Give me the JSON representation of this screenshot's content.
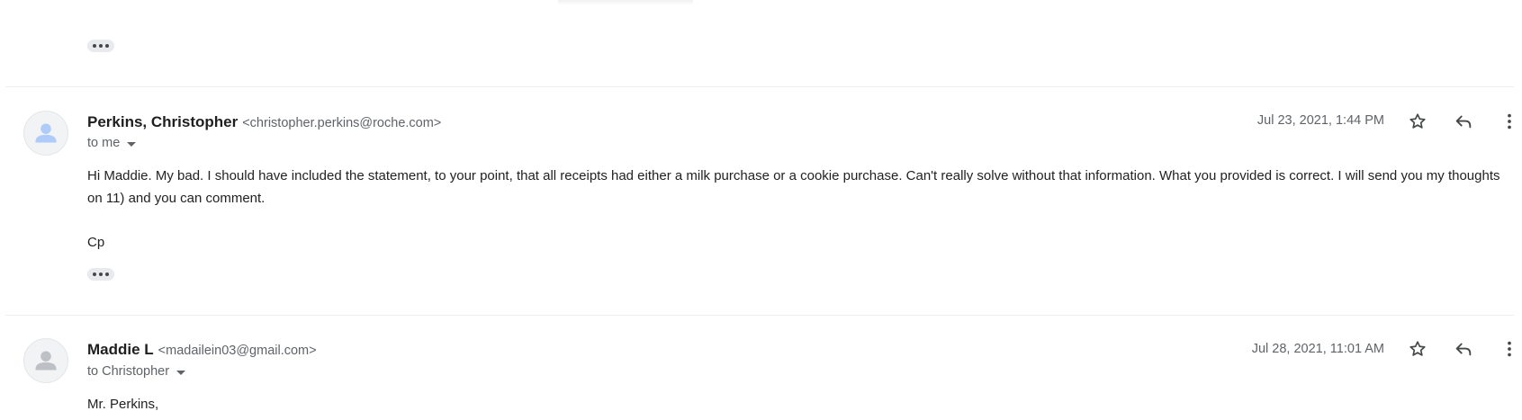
{
  "messages": [
    {
      "sender_name": "Perkins, Christopher",
      "sender_email": "<christopher.perkins@roche.com>",
      "recipients": "to me",
      "date": "Jul 23, 2021, 1:44 PM",
      "body": [
        "Hi Maddie.  My bad.  I should have included the statement, to your point, that all receipts had either a milk purchase or a cookie purchase. Can't really solve without that information.  What you provided is correct.   I will send you my thoughts on 11) and you can comment.",
        "Cp"
      ]
    },
    {
      "sender_name": "Maddie L",
      "sender_email": "<madailein03@gmail.com>",
      "recipients": "to Christopher",
      "date": "Jul 28, 2021, 11:01 AM",
      "body": [
        "Mr. Perkins,"
      ]
    }
  ],
  "icons": {
    "avatar": "person-icon",
    "star": "star-icon",
    "reply": "reply-icon",
    "more": "more-vert-icon",
    "trimmed": "show-trimmed-content-icon",
    "recipient_details": "chevron-down-icon"
  },
  "colors": {
    "avatar_perkins": "#aecbfa",
    "avatar_maddie": "#bdc1c6",
    "secondary_text": "#5f6368"
  }
}
